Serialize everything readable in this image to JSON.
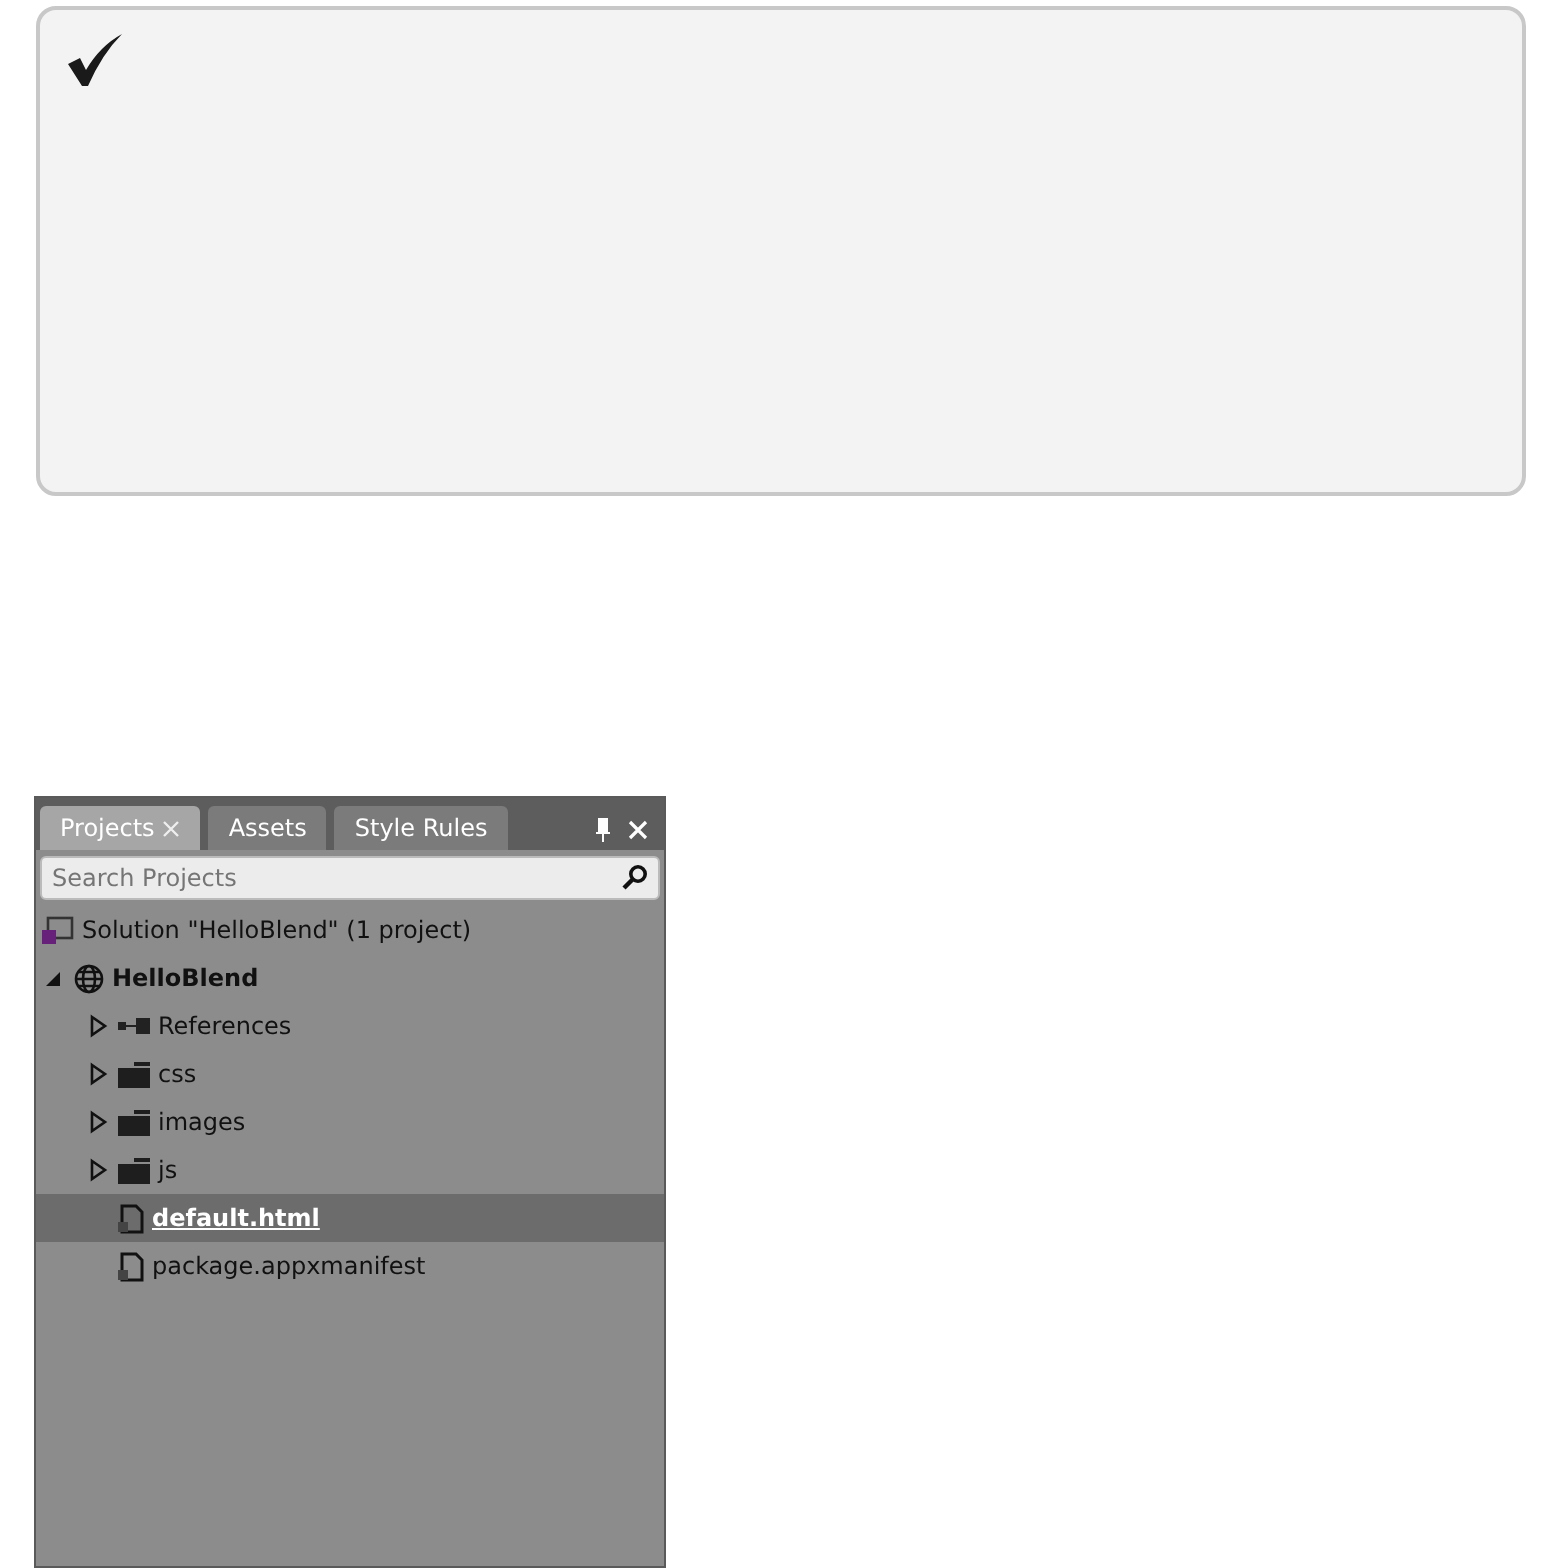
{
  "note": {
    "kind": "check"
  },
  "panel": {
    "tabs": [
      {
        "label": "Projects",
        "selected": true,
        "closable": true
      },
      {
        "label": "Assets",
        "selected": false,
        "closable": false
      },
      {
        "label": "Style Rules",
        "selected": false,
        "closable": false
      }
    ],
    "search": {
      "placeholder": "Search Projects"
    },
    "tree": [
      {
        "label": "Solution \"HelloBlend\" (1 project)",
        "kind": "solution",
        "selected": false
      },
      {
        "label": "HelloBlend",
        "kind": "project",
        "expanded": true,
        "selected": false,
        "children": [
          {
            "label": "References",
            "kind": "references",
            "expanded": false,
            "selected": false
          },
          {
            "label": "css",
            "kind": "folder",
            "expanded": false,
            "selected": false
          },
          {
            "label": "images",
            "kind": "folder",
            "expanded": false,
            "selected": false
          },
          {
            "label": "js",
            "kind": "folder",
            "expanded": false,
            "selected": false
          },
          {
            "label": "default.html",
            "kind": "file",
            "selected": true
          },
          {
            "label": "package.appxmanifest",
            "kind": "file",
            "selected": false
          }
        ]
      }
    ]
  }
}
